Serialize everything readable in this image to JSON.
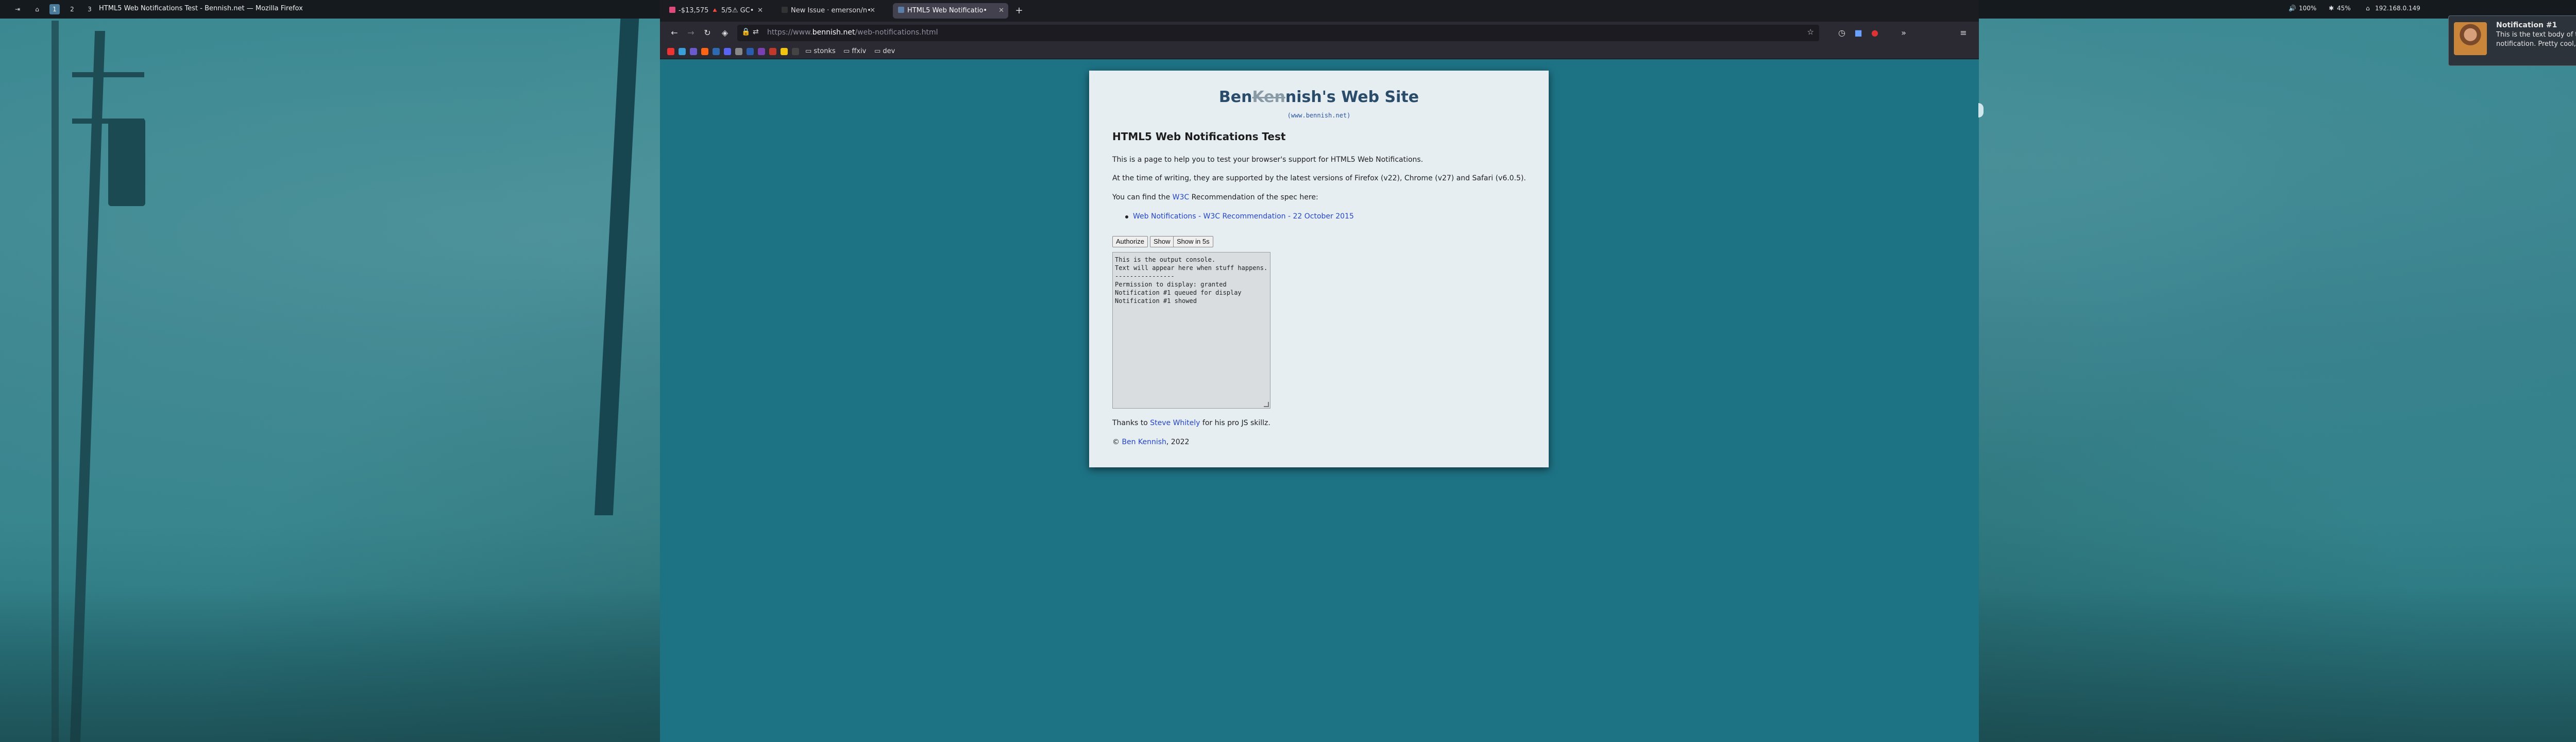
{
  "colors": {
    "desktop_bg": "#2a7884",
    "page_bg": "#1d7284",
    "tab_active": "#42414d",
    "link": "#2545c8",
    "title": "#2a4b6a"
  },
  "topbar": {
    "workspaces": [
      "1",
      "2",
      "3"
    ],
    "window_title": "HTML5 Web Notifications Test - Bennish.net — Mozilla Firefox",
    "status": {
      "volume": "100%",
      "brightness": "45%",
      "ip": "192.168.0.149"
    }
  },
  "browser": {
    "tabs": [
      {
        "label": "-$13,575 🔺 5/5⚠ GC•",
        "icon": "tab-favicon"
      },
      {
        "label": "New Issue · emerson/n•",
        "icon": "github-icon"
      },
      {
        "label": "HTML5 Web Notificatio•",
        "icon": "globe-icon"
      }
    ],
    "url": {
      "scheme": "https://www.",
      "host": "bennish.net",
      "path": "/web-notifications.html"
    },
    "bookmark_folders": [
      "stonks",
      "ffxiv",
      "dev"
    ]
  },
  "page": {
    "title_pre": "Ben",
    "title_strike": "Ken",
    "title_post": "nish's Web Site",
    "site_url": "(www.bennish.net)",
    "heading": "HTML5 Web Notifications Test",
    "p1": "This is a page to help you to test your browser's support for HTML5 Web Notifications.",
    "p2": "At the time of writing, they are supported by the latest versions of Firefox (v22), Chrome (v27) and Safari (v6.0.5).",
    "p3_pre": "You can find the ",
    "p3_link": "W3C",
    "p3_post": " Recommendation of the spec here:",
    "spec_link": "Web Notifications - W3C Recommendation - 22 October 2015",
    "buttons": {
      "authorize": "Authorize",
      "show": "Show",
      "show5": "Show in 5s"
    },
    "console_text": "This is the output console.\nText will appear here when stuff happens.\n----------------\nPermission to display: granted\nNotification #1 queued for display\nNotification #1 showed",
    "thanks_pre": "Thanks to ",
    "thanks_link": "Steve Whitely",
    "thanks_post": " for his pro JS skillz.",
    "copy_pre": "© ",
    "copy_link": "Ben Kennish",
    "copy_post": ", 2022"
  },
  "notification": {
    "title": "Notification #1",
    "body": "This is the text body of the notification. Pretty cool, huh?"
  }
}
